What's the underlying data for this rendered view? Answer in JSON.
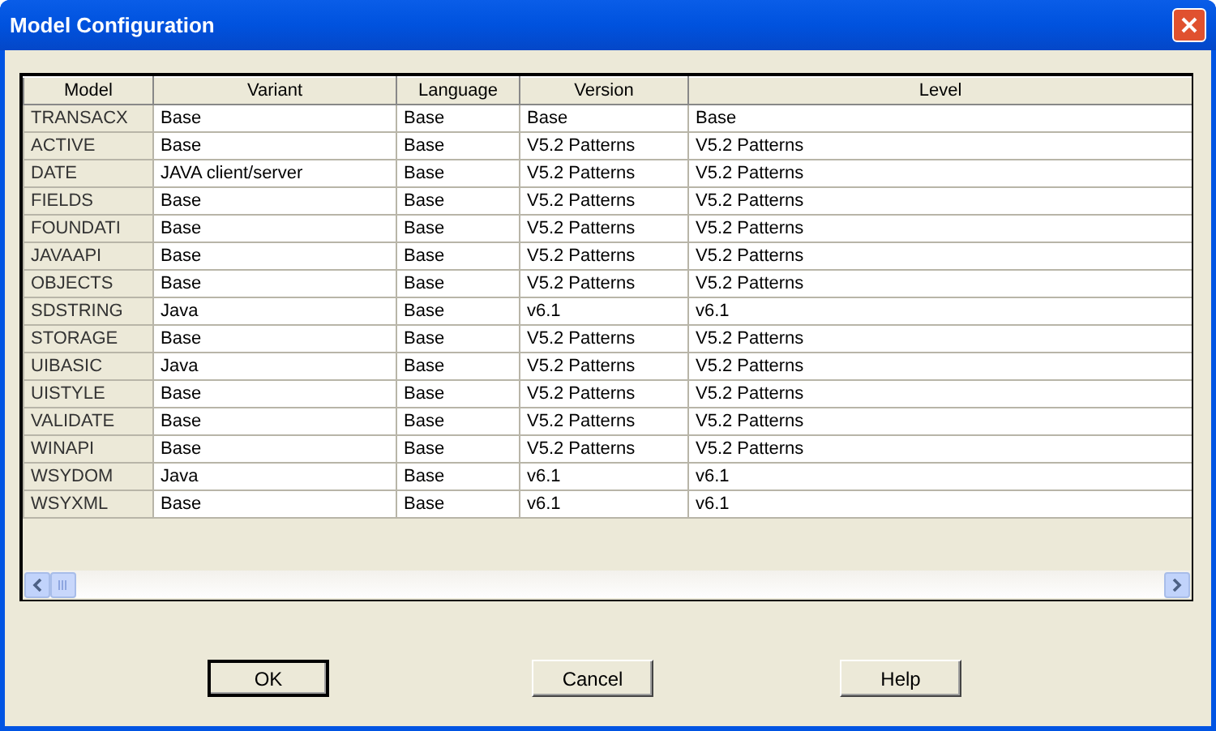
{
  "window": {
    "title": "Model Configuration"
  },
  "table": {
    "columns": [
      "Model",
      "Variant",
      "Language",
      "Version",
      "Level"
    ],
    "rows": [
      [
        "TRANSACX",
        "Base",
        "Base",
        "Base",
        "Base"
      ],
      [
        "ACTIVE",
        "Base",
        "Base",
        "V5.2 Patterns",
        "V5.2 Patterns"
      ],
      [
        "DATE",
        "JAVA client/server",
        "Base",
        "V5.2 Patterns",
        "V5.2 Patterns"
      ],
      [
        "FIELDS",
        "Base",
        "Base",
        "V5.2 Patterns",
        "V5.2 Patterns"
      ],
      [
        "FOUNDATI",
        "Base",
        "Base",
        "V5.2 Patterns",
        "V5.2 Patterns"
      ],
      [
        "JAVAAPI",
        "Base",
        "Base",
        "V5.2 Patterns",
        "V5.2 Patterns"
      ],
      [
        "OBJECTS",
        "Base",
        "Base",
        "V5.2 Patterns",
        "V5.2 Patterns"
      ],
      [
        "SDSTRING",
        "Java",
        "Base",
        "v6.1",
        "v6.1"
      ],
      [
        "STORAGE",
        "Base",
        "Base",
        "V5.2 Patterns",
        "V5.2 Patterns"
      ],
      [
        "UIBASIC",
        "Java",
        "Base",
        "V5.2 Patterns",
        "V5.2 Patterns"
      ],
      [
        "UISTYLE",
        "Base",
        "Base",
        "V5.2 Patterns",
        "V5.2 Patterns"
      ],
      [
        "VALIDATE",
        "Base",
        "Base",
        "V5.2 Patterns",
        "V5.2 Patterns"
      ],
      [
        "WINAPI",
        "Base",
        "Base",
        "V5.2 Patterns",
        "V5.2 Patterns"
      ],
      [
        "WSYDOM",
        "Java",
        "Base",
        "v6.1",
        "v6.1"
      ],
      [
        "WSYXML",
        "Base",
        "Base",
        "v6.1",
        "v6.1"
      ]
    ]
  },
  "buttons": [
    {
      "label": "OK",
      "default": true
    },
    {
      "label": "Cancel",
      "default": false
    },
    {
      "label": "Help",
      "default": false
    }
  ]
}
